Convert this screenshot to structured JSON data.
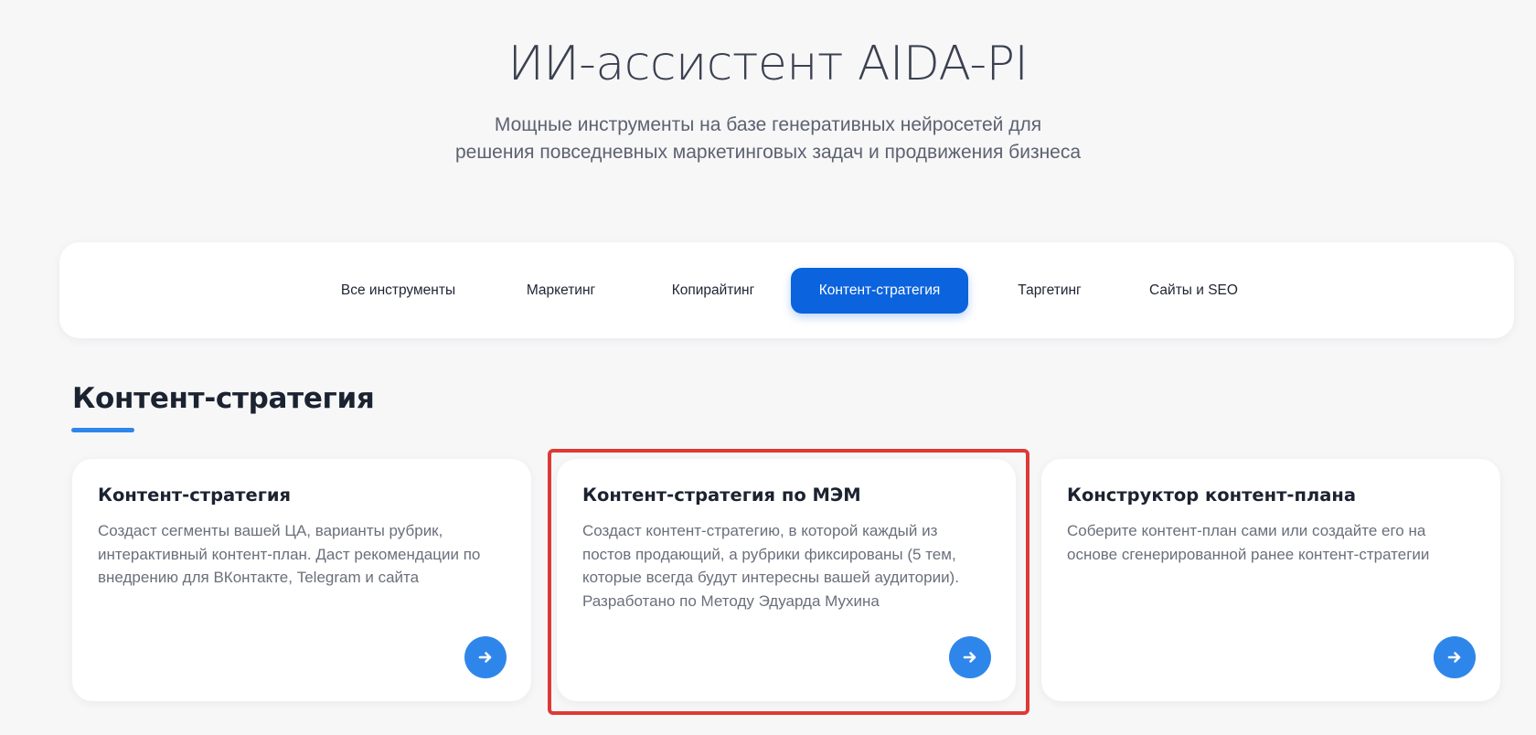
{
  "hero": {
    "title": "ИИ-ассистент AIDA-PI",
    "subtitle_line1": "Мощные инструменты на базе генеративных нейросетей для",
    "subtitle_line2": "решения повседневных маркетинговых задач и продвижения бизнеса"
  },
  "tabs": [
    {
      "label": "Все инструменты",
      "active": false
    },
    {
      "label": "Маркетинг",
      "active": false
    },
    {
      "label": "Копирайтинг",
      "active": false
    },
    {
      "label": "Контент-стратегия",
      "active": true
    },
    {
      "label": "Таргетинг",
      "active": false
    },
    {
      "label": "Сайты и SEO",
      "active": false
    }
  ],
  "section": {
    "title": "Контент-стратегия"
  },
  "cards": [
    {
      "title": "Контент-стратегия",
      "description": "Создаст сегменты вашей ЦА, варианты рубрик, интерактивный контент-план. Даст рекомендации по внедрению для ВКонтакте, Telegram и сайта",
      "button_icon": "arrow-right-icon"
    },
    {
      "title": "Контент-стратегия по МЭМ",
      "description": "Создаст контент-стратегию, в которой каждый из постов продающий, а рубрики фиксированы (5 тем, которые всегда будут интересны вашей аудитории). Разработано по Методу Эдуарда Мухина",
      "button_icon": "arrow-right-icon"
    },
    {
      "title": "Конструктор контент-плана",
      "description": "Соберите контент-план сами или создайте его на основе сгенерированной ранее контент-стратегии",
      "button_icon": "arrow-right-icon"
    }
  ],
  "colors": {
    "accent": "#0b63de",
    "button": "#2f86ea",
    "highlight": "#de3a35",
    "background": "#f7f7f8"
  }
}
